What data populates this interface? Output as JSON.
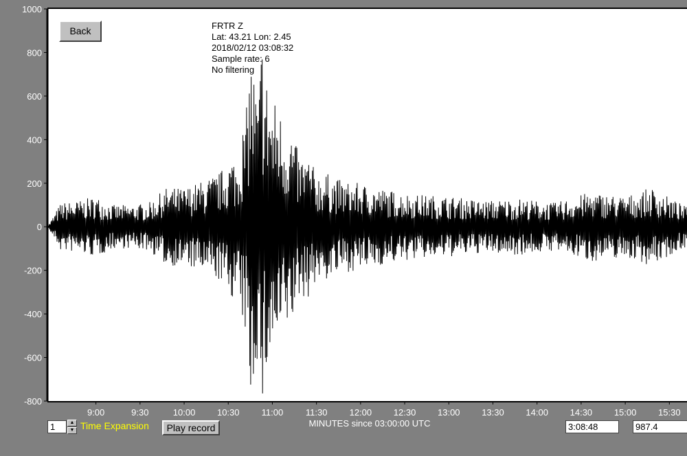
{
  "back_label": "Back",
  "station_info": [
    "FRTR  Z",
    "Lat: 43.21 Lon: 2.45",
    "2018/02/12 03:08:32",
    "Sample rate: 6",
    "No filtering"
  ],
  "controls": {
    "time_expansion_value": "1",
    "time_expansion_label": "Time Expansion",
    "play_label": "Play record",
    "cursor_time": "3:08:48",
    "cursor_value": "987.4"
  },
  "colors": {
    "background": "#808080",
    "plot_background": "#ffffff",
    "trace": "#000000",
    "axis_text": "#ffffff",
    "label_highlight": "#ffff00"
  },
  "chart_data": {
    "type": "line",
    "xlabel": "MINUTES since 03:00:00 UTC",
    "ylabel": "",
    "title": "",
    "ylim": [
      -800,
      1000
    ],
    "xlim": [
      8.45,
      15.7
    ],
    "grid": false,
    "y_ticks": [
      "1000",
      "800",
      "600",
      "400",
      "200",
      "0",
      "-200",
      "-400",
      "-600",
      "-800"
    ],
    "x_ticks": [
      "9:00",
      "9:30",
      "10:00",
      "10:30",
      "11:00",
      "11:30",
      "12:00",
      "12:30",
      "13:00",
      "13:30",
      "14:00",
      "14:30",
      "15:00",
      "15:30"
    ],
    "series": [
      {
        "values": [
          [
            8.45,
            0
          ],
          [
            8.6,
            110
          ],
          [
            8.8,
            -120
          ],
          [
            9.0,
            140
          ],
          [
            9.2,
            -100
          ],
          [
            9.4,
            100
          ],
          [
            9.6,
            -110
          ],
          [
            9.8,
            180
          ],
          [
            10.0,
            -180
          ],
          [
            10.2,
            210
          ],
          [
            10.4,
            -250
          ],
          [
            10.55,
            330
          ],
          [
            10.6,
            -300
          ],
          [
            10.65,
            450
          ],
          [
            10.7,
            -500
          ],
          [
            10.75,
            820
          ],
          [
            10.78,
            -760
          ],
          [
            10.82,
            620
          ],
          [
            10.85,
            -620
          ],
          [
            10.88,
            930
          ],
          [
            10.92,
            -700
          ],
          [
            10.96,
            690
          ],
          [
            11.0,
            -560
          ],
          [
            11.05,
            600
          ],
          [
            11.1,
            -520
          ],
          [
            11.15,
            470
          ],
          [
            11.2,
            -480
          ],
          [
            11.3,
            330
          ],
          [
            11.4,
            -330
          ],
          [
            11.5,
            250
          ],
          [
            11.6,
            -250
          ],
          [
            11.8,
            210
          ],
          [
            12.0,
            -200
          ],
          [
            12.3,
            170
          ],
          [
            12.6,
            -150
          ],
          [
            13.0,
            140
          ],
          [
            13.4,
            -120
          ],
          [
            13.8,
            130
          ],
          [
            14.2,
            -110
          ],
          [
            14.6,
            160
          ],
          [
            15.0,
            -140
          ],
          [
            15.3,
            180
          ],
          [
            15.7,
            -90
          ]
        ]
      }
    ]
  }
}
